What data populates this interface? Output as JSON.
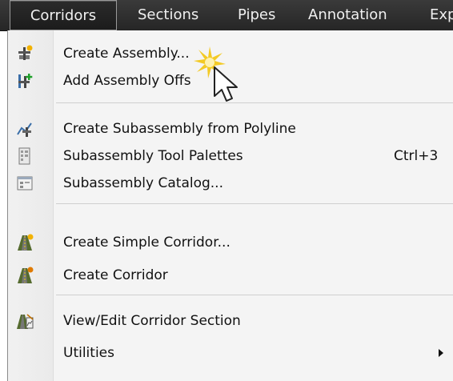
{
  "menubar": {
    "items": [
      {
        "label": "Corridors"
      },
      {
        "label": "Sections"
      },
      {
        "label": "Pipes"
      },
      {
        "label": "Annotation"
      },
      {
        "label": "Exp"
      }
    ]
  },
  "menu": {
    "items": [
      {
        "label": "Create Assembly...",
        "icon": "create-assembly-icon"
      },
      {
        "label": "Add Assembly Offs",
        "icon": "add-assembly-offset-icon"
      },
      {
        "label": "Create Subassembly from Polyline",
        "icon": "subassembly-polyline-icon"
      },
      {
        "label": "Subassembly Tool Palettes",
        "shortcut": "Ctrl+3",
        "icon": "tool-palettes-icon"
      },
      {
        "label": "Subassembly Catalog...",
        "icon": "catalog-icon"
      },
      {
        "label": "Create Simple Corridor...",
        "icon": "simple-corridor-icon"
      },
      {
        "label": "Create Corridor",
        "icon": "corridor-icon"
      },
      {
        "label": "View/Edit Corridor Section",
        "icon": "corridor-section-icon"
      },
      {
        "label": "Utilities",
        "icon": "none",
        "submenu": true
      }
    ]
  },
  "colors": {
    "menubar": "#2e2e2e",
    "menu_bg": "#f4f4f4",
    "cursor_sparkle": "#f2c200"
  }
}
